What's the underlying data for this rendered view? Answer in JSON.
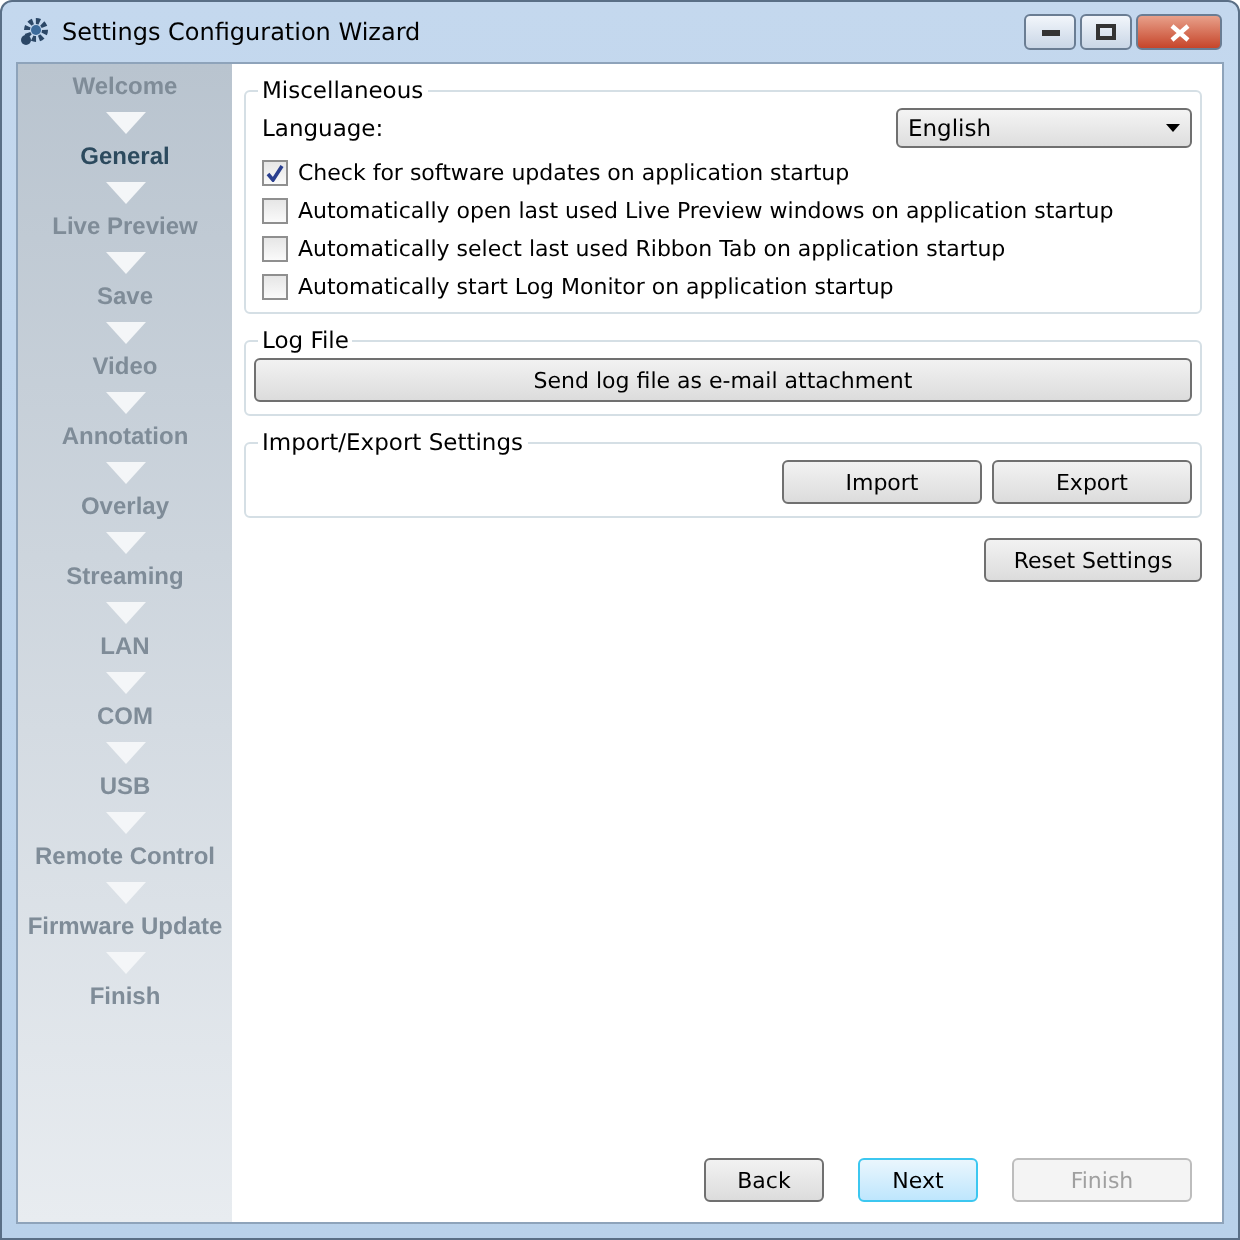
{
  "window": {
    "title": "Settings Configuration Wizard"
  },
  "steps": [
    {
      "label": "Welcome",
      "selected": false
    },
    {
      "label": "General",
      "selected": true
    },
    {
      "label": "Live Preview",
      "selected": false
    },
    {
      "label": "Save",
      "selected": false
    },
    {
      "label": "Video",
      "selected": false
    },
    {
      "label": "Annotation",
      "selected": false
    },
    {
      "label": "Overlay",
      "selected": false
    },
    {
      "label": "Streaming",
      "selected": false
    },
    {
      "label": "LAN",
      "selected": false
    },
    {
      "label": "COM",
      "selected": false
    },
    {
      "label": "USB",
      "selected": false
    },
    {
      "label": "Remote Control",
      "selected": false
    },
    {
      "label": "Firmware Update",
      "selected": false
    },
    {
      "label": "Finish",
      "selected": false
    }
  ],
  "miscellaneous": {
    "title": "Miscellaneous",
    "language_label": "Language:",
    "language_value": "English",
    "options": [
      {
        "label": "Check for software updates on application startup",
        "checked": true
      },
      {
        "label": "Automatically open last used Live Preview windows on application startup",
        "checked": false
      },
      {
        "label": "Automatically select last used Ribbon Tab on application startup",
        "checked": false
      },
      {
        "label": "Automatically start Log Monitor on application startup",
        "checked": false
      }
    ]
  },
  "log_file": {
    "title": "Log File",
    "button": "Send log file as e-mail attachment"
  },
  "import_export": {
    "title": "Import/Export Settings",
    "buttons": [
      "Import",
      "Export"
    ]
  },
  "reset_button": "Reset Settings",
  "nav_buttons": [
    {
      "label": "Back",
      "default": false,
      "disabled": false
    },
    {
      "label": "Next",
      "default": true,
      "disabled": false
    },
    {
      "label": "Finish",
      "default": false,
      "disabled": true
    }
  ]
}
